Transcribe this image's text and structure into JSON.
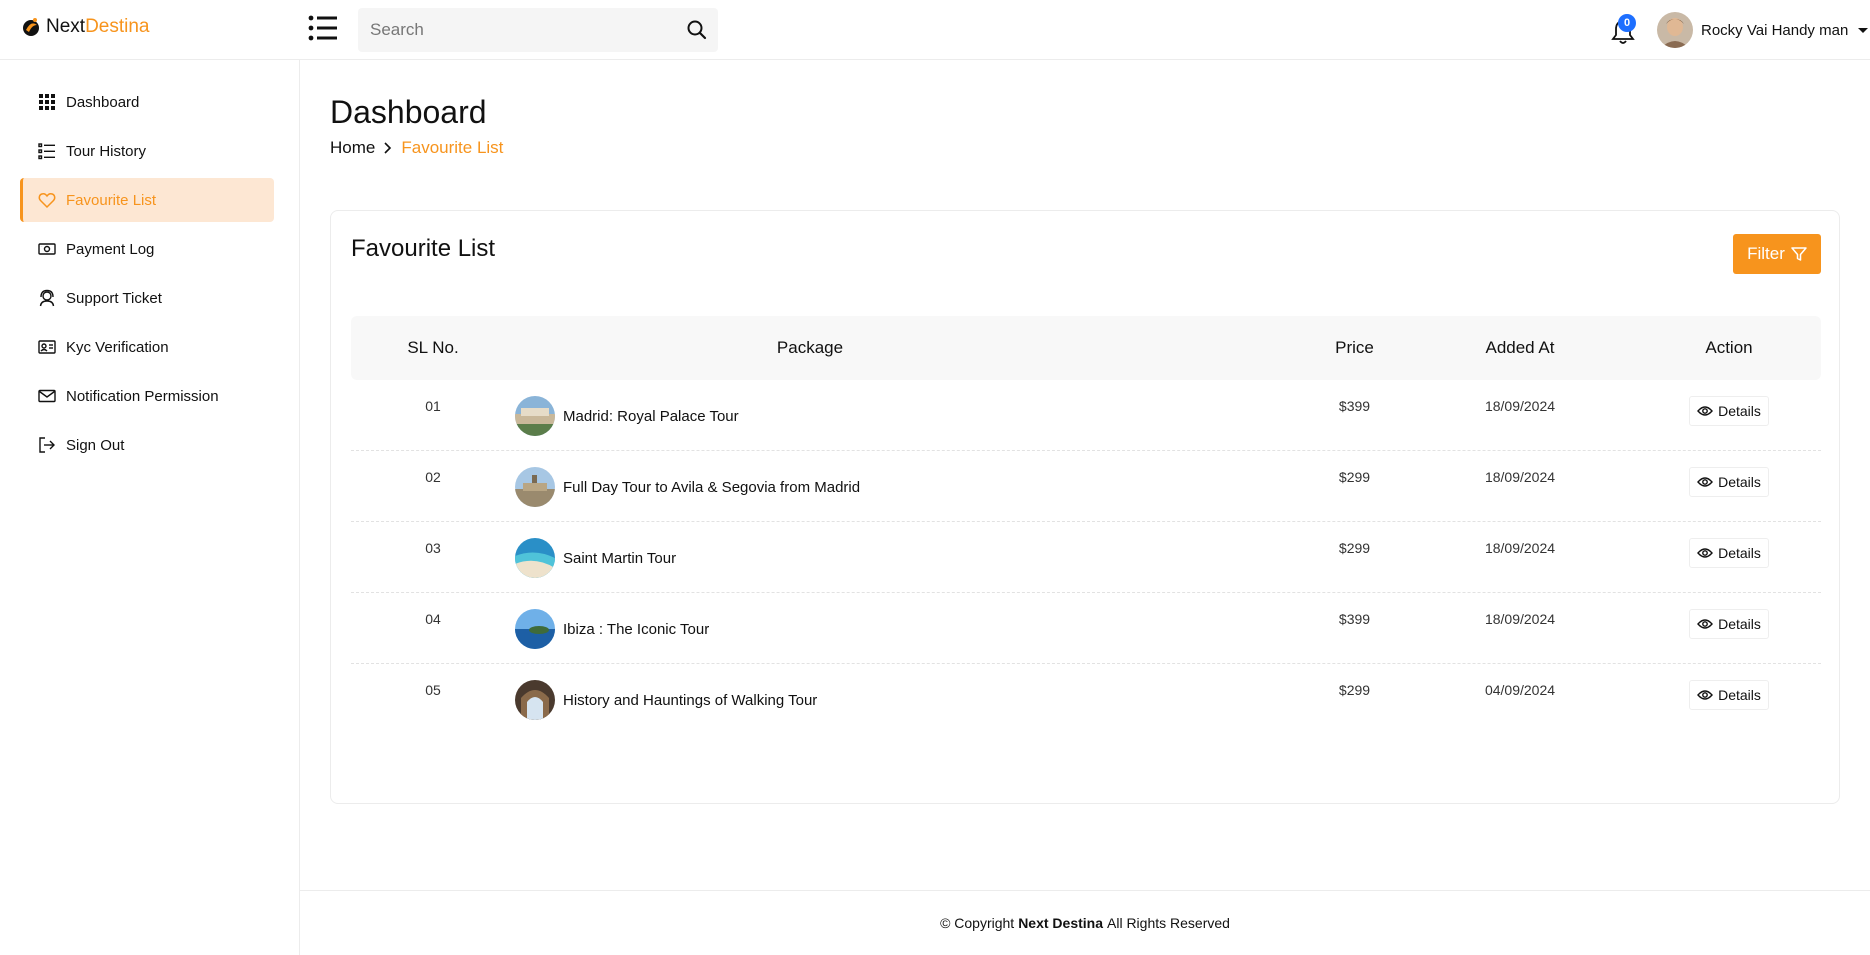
{
  "brand": {
    "part1": "Next",
    "part2": "Destina"
  },
  "header": {
    "search_placeholder": "Search",
    "notification_count": "0",
    "user_name": "Rocky Vai Handy man"
  },
  "sidebar": {
    "items": [
      {
        "label": "Dashboard",
        "icon": "grid-icon"
      },
      {
        "label": "Tour History",
        "icon": "list-icon"
      },
      {
        "label": "Favourite List",
        "icon": "heart-icon",
        "active": true
      },
      {
        "label": "Payment Log",
        "icon": "money-icon"
      },
      {
        "label": "Support Ticket",
        "icon": "headset-icon"
      },
      {
        "label": "Kyc Verification",
        "icon": "id-card-icon"
      },
      {
        "label": "Notification Permission",
        "icon": "envelope-icon"
      },
      {
        "label": "Sign Out",
        "icon": "sign-out-icon"
      }
    ]
  },
  "page": {
    "title": "Dashboard",
    "breadcrumb": {
      "home": "Home",
      "current": "Favourite List"
    }
  },
  "card": {
    "title": "Favourite List",
    "filter_label": "Filter"
  },
  "table": {
    "columns": [
      "SL No.",
      "Package",
      "Price",
      "Added At",
      "Action"
    ],
    "rows": [
      {
        "sl": "01",
        "package": "Madrid: Royal Palace Tour",
        "price": "$399",
        "added": "18/09/2024",
        "action": "Details"
      },
      {
        "sl": "02",
        "package": "Full Day Tour to Avila & Segovia from Madrid",
        "price": "$299",
        "added": "18/09/2024",
        "action": "Details"
      },
      {
        "sl": "03",
        "package": "Saint Martin Tour",
        "price": "$299",
        "added": "18/09/2024",
        "action": "Details"
      },
      {
        "sl": "04",
        "package": "Ibiza : The Iconic Tour",
        "price": "$399",
        "added": "18/09/2024",
        "action": "Details"
      },
      {
        "sl": "05",
        "package": "History and Hauntings of Walking Tour",
        "price": "$299",
        "added": "04/09/2024",
        "action": "Details"
      }
    ]
  },
  "footer": {
    "prefix": "© Copyright",
    "brand": "Next Destina",
    "suffix": "All Rights Reserved"
  },
  "colors": {
    "accent": "#f7941d",
    "accent_light": "#fde7d3",
    "badge": "#1e6fff"
  }
}
